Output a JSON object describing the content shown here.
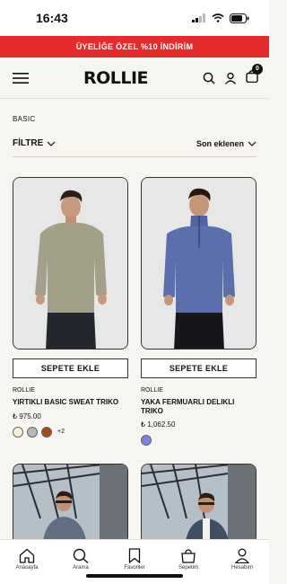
{
  "status": {
    "time": "16:43"
  },
  "promo": {
    "text": "ÜYELİĞE ÖZEL %10 İNDİRİM"
  },
  "header": {
    "logo": "ROLLIE",
    "cart_count": "0"
  },
  "breadcrumb": "BASIC",
  "filter": {
    "label": "FİLTRE",
    "sort_label": "Son eklenen"
  },
  "products": [
    {
      "add_label": "SEPETE EKLE",
      "brand": "ROLLIE",
      "name": "YIRTIKLI BASIC SWEAT TRIKO",
      "price": "₺ 975.00",
      "swatches": [
        "#f3f1d6",
        "#b7b8b9",
        "#a84a14"
      ],
      "more": "+2"
    },
    {
      "add_label": "SEPETE EKLE",
      "brand": "ROLLIE",
      "name": "YAKA FERMUARLI DELIKLI TRIKO",
      "price": "₺ 1,062.50",
      "swatches": [
        "#7b7fe8"
      ],
      "more": ""
    }
  ],
  "tabbar": {
    "home": "Anasayfa",
    "search": "Arama",
    "favorites": "Favoriler",
    "cart": "Sepetim",
    "account": "Hesabım"
  },
  "colors": {
    "promo_bg": "#e52b2b",
    "background": "#f7f5f0"
  }
}
